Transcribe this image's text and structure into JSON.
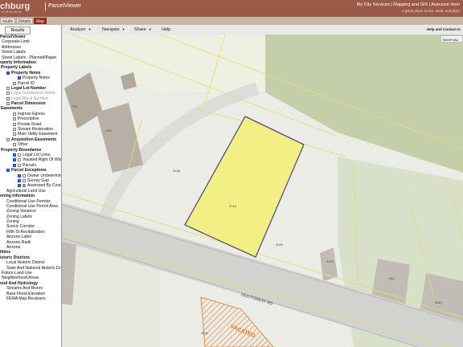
{
  "header": {
    "brand": "chburg",
    "brand_sub": "VIRGINIA",
    "app_title": "ParcelViewer",
    "links": "My City Services | Mapping and GIS | Assessor Hom",
    "tagline": "A great place to live, work, and play!"
  },
  "tabs": [
    {
      "label": "esults",
      "active": false
    },
    {
      "label": "Details",
      "active": false
    },
    {
      "label": "Map",
      "active": true
    }
  ],
  "sidebar": {
    "results_tab": "Results",
    "layers": [
      {
        "label": "ParcelViewer",
        "style": "bold",
        "indent": 0,
        "check": null
      },
      {
        "label": "Corporate Limit",
        "indent": 2,
        "check": null
      },
      {
        "label": "Addresses",
        "indent": 2,
        "check": null
      },
      {
        "label": "Street Labels",
        "indent": 2,
        "check": null
      },
      {
        "label": "Street Labels - Planned/Paper",
        "indent": 2,
        "check": null
      },
      {
        "label": "operty Information",
        "style": "bold",
        "indent": 0,
        "check": null
      },
      {
        "label": "Property Labels",
        "style": "bold",
        "indent": 1,
        "check": null
      },
      {
        "label": "Property Notes",
        "style": "bold",
        "indent": 8,
        "check": true
      },
      {
        "label": "Property Notes",
        "indent": 22,
        "check": true
      },
      {
        "label": "Parcel ID",
        "indent": 16,
        "check": false
      },
      {
        "label": "Legal Lot Number",
        "style": "bold",
        "indent": 8,
        "check": false
      },
      {
        "label": "Legal Subdivision Name",
        "style": "grey",
        "indent": 8,
        "check": false
      },
      {
        "label": "Legal Block Number",
        "style": "grey",
        "indent": 8,
        "check": false
      },
      {
        "label": "Parcel Dimension",
        "style": "bold",
        "indent": 8,
        "check": false
      },
      {
        "label": "Easements",
        "style": "bold",
        "indent": 1,
        "check": null
      },
      {
        "label": "Ingress Egress",
        "indent": 16,
        "check": false
      },
      {
        "label": "Prescriptive",
        "indent": 16,
        "check": false
      },
      {
        "label": "Private Road",
        "indent": 16,
        "check": false
      },
      {
        "label": "Stream Restoration",
        "indent": 16,
        "check": false
      },
      {
        "label": "Main Utility Easement",
        "indent": 16,
        "check": false
      },
      {
        "label": "Acquisition Easements",
        "style": "bold",
        "indent": 8,
        "check": false
      },
      {
        "label": "Other",
        "indent": 16,
        "check": false
      },
      {
        "label": "Property Boundaries",
        "style": "bold",
        "indent": 1,
        "check": null
      },
      {
        "label": "Legal Lot Lines",
        "indent": 16,
        "check": true,
        "swatch": "#ffffff"
      },
      {
        "label": "Vacated Right Of Way",
        "indent": 16,
        "check": true,
        "swatch": "#ffffff"
      },
      {
        "label": "Parcels",
        "indent": 16,
        "check": true,
        "swatch": "#ffffff"
      },
      {
        "label": "Parcel Exceptions",
        "style": "bold",
        "indent": 8,
        "check": true
      },
      {
        "label": "Owner Undetermined",
        "indent": 22,
        "check": true,
        "swatch": "#ffffff"
      },
      {
        "label": "Survey Gap",
        "indent": 22,
        "check": true,
        "swatch": "#ffffff"
      },
      {
        "label": "Assessed By County",
        "indent": 22,
        "check": true,
        "swatch": "#9aaa88"
      },
      {
        "label": "Agricultural Land Use",
        "indent": 8,
        "check": null
      },
      {
        "label": "oning Information",
        "style": "bold",
        "indent": 0,
        "check": null
      },
      {
        "label": "Conditional Use Permits",
        "indent": 8,
        "check": null
      },
      {
        "label": "Conditional Use Permit Area",
        "indent": 8,
        "check": null
      },
      {
        "label": "Zoning Variance",
        "indent": 8,
        "check": null
      },
      {
        "label": "Zoning Labels",
        "indent": 8,
        "check": null
      },
      {
        "label": "Zoning",
        "indent": 8,
        "check": null
      },
      {
        "label": "Scenic Corridor",
        "indent": 8,
        "check": null
      },
      {
        "label": "Fifth St Revitalization",
        "indent": 8,
        "check": null
      },
      {
        "label": "Airzone Label",
        "indent": 8,
        "check": null
      },
      {
        "label": "Airzone Radii",
        "indent": 8,
        "check": null
      },
      {
        "label": "Airzone",
        "indent": 8,
        "check": null
      },
      {
        "label": "ilities",
        "style": "bold",
        "indent": 0,
        "check": null
      },
      {
        "label": "istoric Districts",
        "style": "bold",
        "indent": 0,
        "check": null
      },
      {
        "label": "Local Historic District",
        "indent": 8,
        "check": null
      },
      {
        "label": "State And National Historic Di",
        "indent": 8,
        "check": null
      },
      {
        "label": "Future Land Use",
        "indent": 2,
        "check": null
      },
      {
        "label": "Neighborhood Areas",
        "indent": 2,
        "check": null
      },
      {
        "label": "ood And Hydrology",
        "style": "bold",
        "indent": 0,
        "check": null
      },
      {
        "label": "Streams And Rivers",
        "indent": 8,
        "check": null
      },
      {
        "label": "Base Flood Elevation",
        "indent": 8,
        "check": null
      },
      {
        "label": "FEMA Map Revisions",
        "indent": 8,
        "check": null
      }
    ]
  },
  "toolbar": {
    "analyze": "Analyze",
    "navigate": "Navigate",
    "share": "Share",
    "help": "Help",
    "right": "Help and Contact In"
  },
  "basemap_label": "Basemap",
  "map": {
    "road_name": "OLD FOREST RD",
    "vacated_label": "VACATED",
    "labels": [
      "921",
      "913",
      "3038",
      "3715",
      "3026",
      "3073",
      "N/A",
      "3010",
      "3041"
    ],
    "colors": {
      "highlight_fill": "#f3f07a",
      "highlight_outline": "#55507a",
      "parcel_lines": "#e4dd6a",
      "road": "#cfcfcf",
      "vacated_hatch": "#e07a2a"
    }
  }
}
